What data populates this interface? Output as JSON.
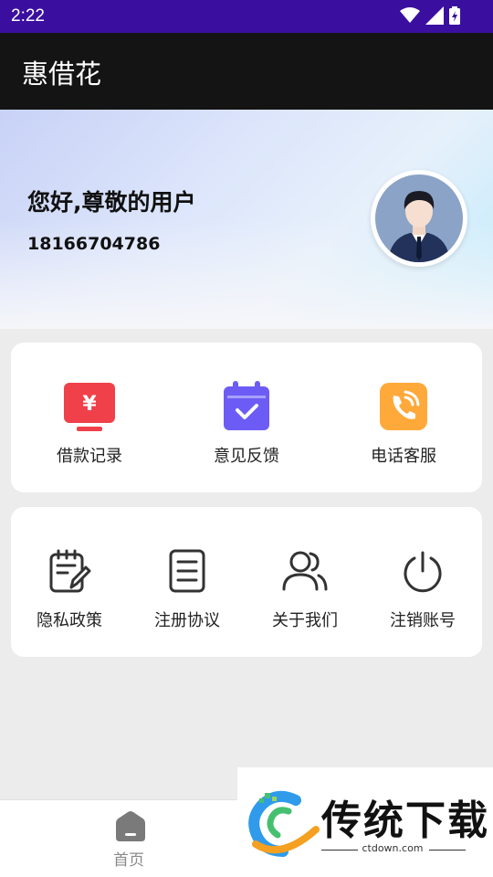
{
  "status_bar": {
    "time": "2:22"
  },
  "app_bar": {
    "title": "惠借花"
  },
  "profile": {
    "greeting": "您好,尊敬的用户",
    "phone": "18166704786"
  },
  "quick_actions": [
    {
      "label": "借款记录",
      "icon": "loan-record-icon",
      "color": "#f0404a"
    },
    {
      "label": "意见反馈",
      "icon": "feedback-calendar-icon",
      "color": "#6c5cf5"
    },
    {
      "label": "电话客服",
      "icon": "phone-service-icon",
      "color": "#ffa93a"
    }
  ],
  "settings": [
    {
      "label": "隐私政策",
      "icon": "privacy-policy-icon"
    },
    {
      "label": "注册协议",
      "icon": "agreement-document-icon"
    },
    {
      "label": "关于我们",
      "icon": "users-icon"
    },
    {
      "label": "注销账号",
      "icon": "power-icon"
    }
  ],
  "bottom_nav": {
    "home_label": "首页"
  },
  "watermark": {
    "brand": "传统下载",
    "url": "ctdown.com"
  }
}
